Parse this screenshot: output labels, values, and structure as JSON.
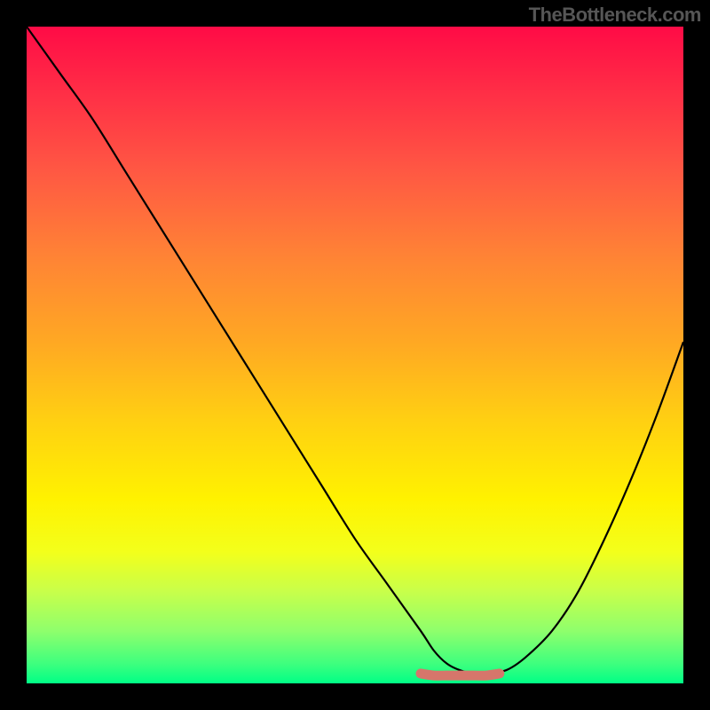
{
  "watermark": "TheBottleneck.com",
  "chart_data": {
    "type": "line",
    "title": "",
    "xlabel": "",
    "ylabel": "",
    "xlim": [
      0,
      100
    ],
    "ylim": [
      0,
      100
    ],
    "grid": false,
    "series": [
      {
        "name": "curve",
        "x": [
          0,
          5,
          10,
          15,
          20,
          25,
          30,
          35,
          40,
          45,
          50,
          55,
          60,
          62,
          64,
          66,
          68,
          70,
          73,
          76,
          80,
          84,
          88,
          92,
          96,
          100
        ],
        "y": [
          100,
          93,
          86,
          78,
          70,
          62,
          54,
          46,
          38,
          30,
          22,
          15,
          8,
          5,
          3,
          2,
          1.5,
          1.5,
          2,
          4,
          8,
          14,
          22,
          31,
          41,
          52
        ]
      },
      {
        "name": "marker-band",
        "x": [
          60,
          62,
          64,
          66,
          68,
          70,
          72
        ],
        "y": [
          1.5,
          1.2,
          1.2,
          1.2,
          1.2,
          1.2,
          1.5
        ]
      }
    ],
    "gradient_stops": [
      {
        "pos": 0,
        "color": "#ff0b46"
      },
      {
        "pos": 10,
        "color": "#ff2e46"
      },
      {
        "pos": 22,
        "color": "#ff5843"
      },
      {
        "pos": 35,
        "color": "#ff8335"
      },
      {
        "pos": 48,
        "color": "#ffa823"
      },
      {
        "pos": 60,
        "color": "#ffd012"
      },
      {
        "pos": 72,
        "color": "#fff200"
      },
      {
        "pos": 80,
        "color": "#f3ff1b"
      },
      {
        "pos": 86,
        "color": "#c8ff4a"
      },
      {
        "pos": 92,
        "color": "#8fff6c"
      },
      {
        "pos": 97,
        "color": "#3eff7e"
      },
      {
        "pos": 100,
        "color": "#00ff86"
      }
    ],
    "marker_color": "#d6766b",
    "curve_color": "#000000"
  }
}
